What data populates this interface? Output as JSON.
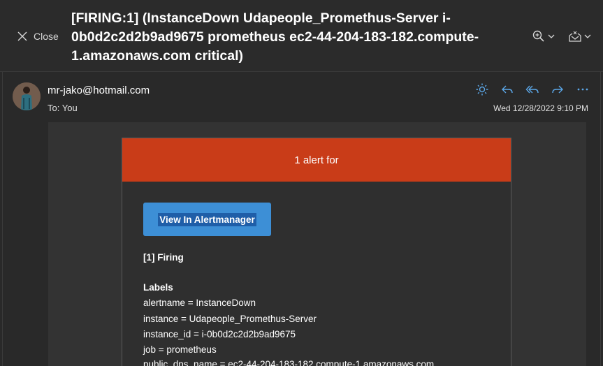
{
  "header": {
    "close_label": "Close",
    "subject": "[FIRING:1] (InstanceDown Udapeople_Promethus-Server i-0b0d2c2d2b9ad9675 prometheus ec2-44-204-183-182.compute-1.amazonaws.com critical)",
    "tools": [
      "zoom-icon",
      "immersive-reader-icon"
    ]
  },
  "message": {
    "sender": "mr-jako@hotmail.com",
    "to_label": "To:",
    "to_value": "You",
    "date": "Wed 12/28/2022 9:10 PM",
    "actions": [
      "sun-icon",
      "reply-icon",
      "reply-all-icon",
      "forward-icon",
      "more-icon"
    ]
  },
  "email": {
    "banner": "1 alert for",
    "button_label": "View In Alertmanager",
    "firing": "[1] Firing",
    "labels_heading": "Labels",
    "labels": [
      "alertname = InstanceDown",
      "instance = Udapeople_Promethus-Server",
      "instance_id = i-0b0d2c2d2b9ad9675",
      "job = prometheus",
      "public_dns_name = ec2-44-204-183-182.compute-1.amazonaws.com"
    ]
  },
  "colors": {
    "banner": "#c93c18",
    "button": "#3d8fd6",
    "accent": "#5ba7e8"
  }
}
